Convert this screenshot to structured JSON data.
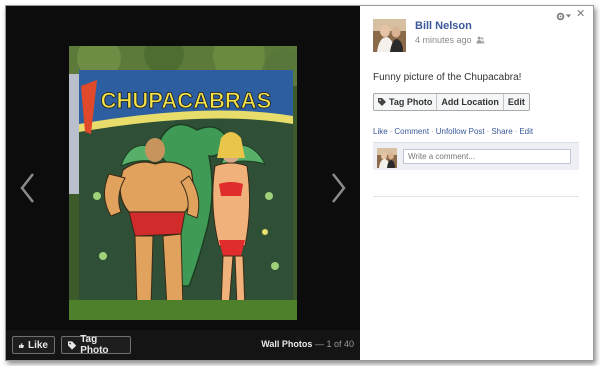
{
  "viewer": {
    "album_name": "Wall Photos",
    "album_separator": "—",
    "position": "1 of 40",
    "like_label": "Like",
    "tag_photo_label": "Tag Photo",
    "sign_text": "CHUPACABRAS"
  },
  "post": {
    "author": "Bill Nelson",
    "timestamp": "4 minutes ago",
    "caption": "Funny picture of the Chupacabra!",
    "actions": [
      "Tag Photo",
      "Add Location",
      "Edit"
    ],
    "links": [
      "Like",
      "Comment",
      "Unfollow Post",
      "Share",
      "Edit"
    ],
    "link_separator": "·",
    "comment_placeholder": "Write a comment...",
    "close_glyph": "✕"
  },
  "colors": {
    "link_blue": "#3b5998",
    "stage_bg": "#0c0c0c",
    "comment_bg": "#edeff4"
  },
  "icons": [
    "chevron-left-icon",
    "chevron-right-icon",
    "thumbs-up-icon",
    "tag-icon",
    "gear-icon",
    "privacy-friends-icon",
    "close-icon"
  ]
}
